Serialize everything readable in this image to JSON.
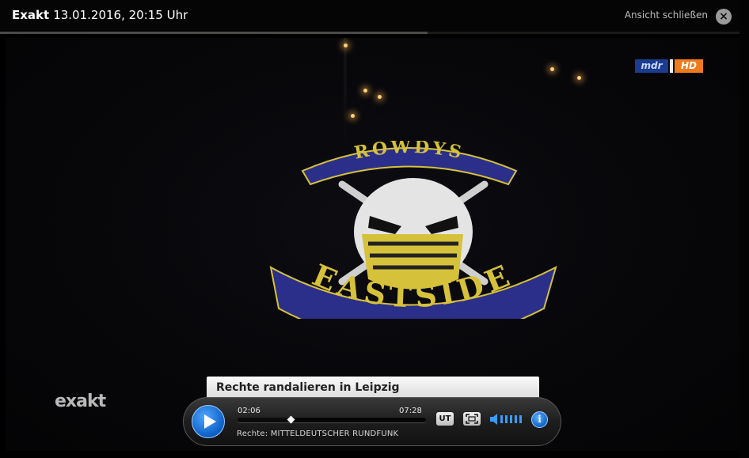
{
  "header": {
    "program": "Exakt",
    "datetime": "13.01.2016, 20:15 Uhr",
    "close_label": "Ansicht schließen",
    "close_icon": "×"
  },
  "video": {
    "channel_logo": "mdr",
    "hd_badge": "HD",
    "emblem_top_text": "ROWDYS",
    "emblem_bottom_text": "EASTSIDE",
    "show_logo": "exakt",
    "caption": "Rechte randalieren in Leipzig"
  },
  "player": {
    "current_time": "02:06",
    "total_time": "07:28",
    "progress": 0.281,
    "rights": "Rechte: MITTELDEUTSCHER RUNDFUNK",
    "subtitles_label": "UT",
    "info_label": "i"
  },
  "colors": {
    "accent_blue": "#1a7ae0",
    "hd_orange": "#f07b1d",
    "emblem_gold": "#d6c13a",
    "emblem_blue": "#2b2f8a"
  }
}
